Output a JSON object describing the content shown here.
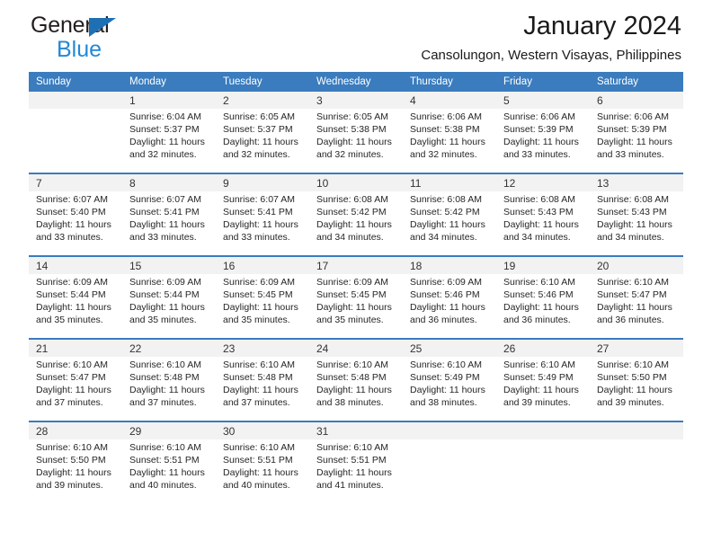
{
  "brand": {
    "name_part1": "General",
    "name_part2": "Blue",
    "accent_color": "#2388d6",
    "triangle_color": "#1f6fb5"
  },
  "header": {
    "title": "January 2024",
    "location": "Cansolungon, Western Visayas, Philippines",
    "header_bg_color": "#3a7cbe",
    "daynum_bg_color": "#f2f2f2"
  },
  "weekday_headers": [
    "Sunday",
    "Monday",
    "Tuesday",
    "Wednesday",
    "Thursday",
    "Friday",
    "Saturday"
  ],
  "weeks": [
    {
      "days": [
        {
          "num": "",
          "sunrise": "",
          "sunset": "",
          "daylight": ""
        },
        {
          "num": "1",
          "sunrise": "Sunrise: 6:04 AM",
          "sunset": "Sunset: 5:37 PM",
          "daylight": "Daylight: 11 hours and 32 minutes."
        },
        {
          "num": "2",
          "sunrise": "Sunrise: 6:05 AM",
          "sunset": "Sunset: 5:37 PM",
          "daylight": "Daylight: 11 hours and 32 minutes."
        },
        {
          "num": "3",
          "sunrise": "Sunrise: 6:05 AM",
          "sunset": "Sunset: 5:38 PM",
          "daylight": "Daylight: 11 hours and 32 minutes."
        },
        {
          "num": "4",
          "sunrise": "Sunrise: 6:06 AM",
          "sunset": "Sunset: 5:38 PM",
          "daylight": "Daylight: 11 hours and 32 minutes."
        },
        {
          "num": "5",
          "sunrise": "Sunrise: 6:06 AM",
          "sunset": "Sunset: 5:39 PM",
          "daylight": "Daylight: 11 hours and 33 minutes."
        },
        {
          "num": "6",
          "sunrise": "Sunrise: 6:06 AM",
          "sunset": "Sunset: 5:39 PM",
          "daylight": "Daylight: 11 hours and 33 minutes."
        }
      ]
    },
    {
      "days": [
        {
          "num": "7",
          "sunrise": "Sunrise: 6:07 AM",
          "sunset": "Sunset: 5:40 PM",
          "daylight": "Daylight: 11 hours and 33 minutes."
        },
        {
          "num": "8",
          "sunrise": "Sunrise: 6:07 AM",
          "sunset": "Sunset: 5:41 PM",
          "daylight": "Daylight: 11 hours and 33 minutes."
        },
        {
          "num": "9",
          "sunrise": "Sunrise: 6:07 AM",
          "sunset": "Sunset: 5:41 PM",
          "daylight": "Daylight: 11 hours and 33 minutes."
        },
        {
          "num": "10",
          "sunrise": "Sunrise: 6:08 AM",
          "sunset": "Sunset: 5:42 PM",
          "daylight": "Daylight: 11 hours and 34 minutes."
        },
        {
          "num": "11",
          "sunrise": "Sunrise: 6:08 AM",
          "sunset": "Sunset: 5:42 PM",
          "daylight": "Daylight: 11 hours and 34 minutes."
        },
        {
          "num": "12",
          "sunrise": "Sunrise: 6:08 AM",
          "sunset": "Sunset: 5:43 PM",
          "daylight": "Daylight: 11 hours and 34 minutes."
        },
        {
          "num": "13",
          "sunrise": "Sunrise: 6:08 AM",
          "sunset": "Sunset: 5:43 PM",
          "daylight": "Daylight: 11 hours and 34 minutes."
        }
      ]
    },
    {
      "days": [
        {
          "num": "14",
          "sunrise": "Sunrise: 6:09 AM",
          "sunset": "Sunset: 5:44 PM",
          "daylight": "Daylight: 11 hours and 35 minutes."
        },
        {
          "num": "15",
          "sunrise": "Sunrise: 6:09 AM",
          "sunset": "Sunset: 5:44 PM",
          "daylight": "Daylight: 11 hours and 35 minutes."
        },
        {
          "num": "16",
          "sunrise": "Sunrise: 6:09 AM",
          "sunset": "Sunset: 5:45 PM",
          "daylight": "Daylight: 11 hours and 35 minutes."
        },
        {
          "num": "17",
          "sunrise": "Sunrise: 6:09 AM",
          "sunset": "Sunset: 5:45 PM",
          "daylight": "Daylight: 11 hours and 35 minutes."
        },
        {
          "num": "18",
          "sunrise": "Sunrise: 6:09 AM",
          "sunset": "Sunset: 5:46 PM",
          "daylight": "Daylight: 11 hours and 36 minutes."
        },
        {
          "num": "19",
          "sunrise": "Sunrise: 6:10 AM",
          "sunset": "Sunset: 5:46 PM",
          "daylight": "Daylight: 11 hours and 36 minutes."
        },
        {
          "num": "20",
          "sunrise": "Sunrise: 6:10 AM",
          "sunset": "Sunset: 5:47 PM",
          "daylight": "Daylight: 11 hours and 36 minutes."
        }
      ]
    },
    {
      "days": [
        {
          "num": "21",
          "sunrise": "Sunrise: 6:10 AM",
          "sunset": "Sunset: 5:47 PM",
          "daylight": "Daylight: 11 hours and 37 minutes."
        },
        {
          "num": "22",
          "sunrise": "Sunrise: 6:10 AM",
          "sunset": "Sunset: 5:48 PM",
          "daylight": "Daylight: 11 hours and 37 minutes."
        },
        {
          "num": "23",
          "sunrise": "Sunrise: 6:10 AM",
          "sunset": "Sunset: 5:48 PM",
          "daylight": "Daylight: 11 hours and 37 minutes."
        },
        {
          "num": "24",
          "sunrise": "Sunrise: 6:10 AM",
          "sunset": "Sunset: 5:48 PM",
          "daylight": "Daylight: 11 hours and 38 minutes."
        },
        {
          "num": "25",
          "sunrise": "Sunrise: 6:10 AM",
          "sunset": "Sunset: 5:49 PM",
          "daylight": "Daylight: 11 hours and 38 minutes."
        },
        {
          "num": "26",
          "sunrise": "Sunrise: 6:10 AM",
          "sunset": "Sunset: 5:49 PM",
          "daylight": "Daylight: 11 hours and 39 minutes."
        },
        {
          "num": "27",
          "sunrise": "Sunrise: 6:10 AM",
          "sunset": "Sunset: 5:50 PM",
          "daylight": "Daylight: 11 hours and 39 minutes."
        }
      ]
    },
    {
      "days": [
        {
          "num": "28",
          "sunrise": "Sunrise: 6:10 AM",
          "sunset": "Sunset: 5:50 PM",
          "daylight": "Daylight: 11 hours and 39 minutes."
        },
        {
          "num": "29",
          "sunrise": "Sunrise: 6:10 AM",
          "sunset": "Sunset: 5:51 PM",
          "daylight": "Daylight: 11 hours and 40 minutes."
        },
        {
          "num": "30",
          "sunrise": "Sunrise: 6:10 AM",
          "sunset": "Sunset: 5:51 PM",
          "daylight": "Daylight: 11 hours and 40 minutes."
        },
        {
          "num": "31",
          "sunrise": "Sunrise: 6:10 AM",
          "sunset": "Sunset: 5:51 PM",
          "daylight": "Daylight: 11 hours and 41 minutes."
        },
        {
          "num": "",
          "sunrise": "",
          "sunset": "",
          "daylight": ""
        },
        {
          "num": "",
          "sunrise": "",
          "sunset": "",
          "daylight": ""
        },
        {
          "num": "",
          "sunrise": "",
          "sunset": "",
          "daylight": ""
        }
      ]
    }
  ]
}
